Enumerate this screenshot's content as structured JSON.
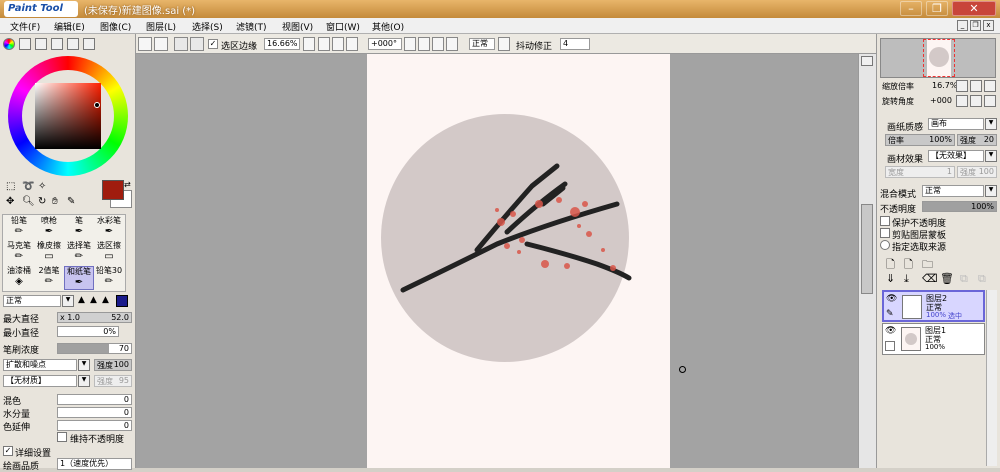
{
  "app": {
    "logo": "Paint Tool SAI",
    "window_title": "(未保存)新建图像.sai (*)"
  },
  "menu": [
    "文件(F)",
    "编辑(E)",
    "图像(C)",
    "图层(L)",
    "选择(S)",
    "滤镜(T)",
    "视图(V)",
    "窗口(W)",
    "其他(O)"
  ],
  "toolbar": {
    "select_edge_label": "选区边缘",
    "zoom": "16.66%",
    "rotation": "+000°",
    "blend": "正常",
    "stabilizer_label": "抖动修正",
    "stabilizer_value": "4"
  },
  "navigator": {
    "zoom_label": "缩放倍率",
    "zoom_value": "16.7%",
    "rotate_label": "旋转角度",
    "rotate_value": "+000"
  },
  "paper": {
    "texture_label": "画纸质感",
    "texture_value": "画布",
    "scale_label": "倍率",
    "scale_value": "100%",
    "strength_label": "强度",
    "strength_value": "20",
    "effect_label": "画材效果",
    "effect_value": "【无效果】",
    "effect_scale_label": "宽度",
    "effect_scale_value": "1",
    "effect_strength_label": "强度",
    "effect_strength_value": "100"
  },
  "layer_props": {
    "blend_label": "混合模式",
    "blend_value": "正常",
    "opacity_label": "不透明度",
    "opacity_value": "100%",
    "opacity": 1.0,
    "protect_label": "保护不透明度",
    "clip_label": "剪贴图层蒙板",
    "source_label": "指定选取来源"
  },
  "layers": [
    {
      "name": "图层2",
      "mode": "正常",
      "opacity": "100%",
      "extra": "选中"
    },
    {
      "name": "图层1",
      "mode": "正常",
      "opacity": "100%",
      "extra": ""
    }
  ],
  "colors": {
    "primary": "#a01c0e",
    "secondary": "#ffffff",
    "title_bar": "#d49a4c",
    "canvas_circle": "#d3c9c8",
    "canvas_paper": "#fdf5f3",
    "branch": "#222222",
    "blossom": "#d9564a"
  },
  "tools": [
    [
      "铅笔",
      "喷枪",
      "笔",
      "水彩笔"
    ],
    [
      "马克笔",
      "橡皮擦",
      "选择笔",
      "选区擦"
    ],
    [
      "油漆桶",
      "2值笔",
      "和纸笔",
      "铅笔30"
    ]
  ],
  "brush": {
    "mode": "正常",
    "max_size_label": "最大直径",
    "max_size_mult": "x 1.0",
    "max_size_value": "52.0",
    "min_size_label": "最小直径",
    "min_size_value": "0%",
    "density_label": "笔刷浓度",
    "density_value": "70",
    "density": 0.7,
    "shape_value": "扩散和噪点",
    "shape_strength_label": "强度",
    "shape_strength_value": "100",
    "texture_value": "【无材质】",
    "texture_strength_label": "强度",
    "texture_strength_value": "95",
    "blend_label": "混色",
    "blend_value": "0",
    "water_label": "水分量",
    "water_value": "0",
    "persist_label": "色延伸",
    "persist_value": "0",
    "keep_opacity_label": "维持不透明度",
    "detail_label": "详细设置",
    "quality_label": "绘画品质",
    "quality_value": "1（速度优先）"
  }
}
